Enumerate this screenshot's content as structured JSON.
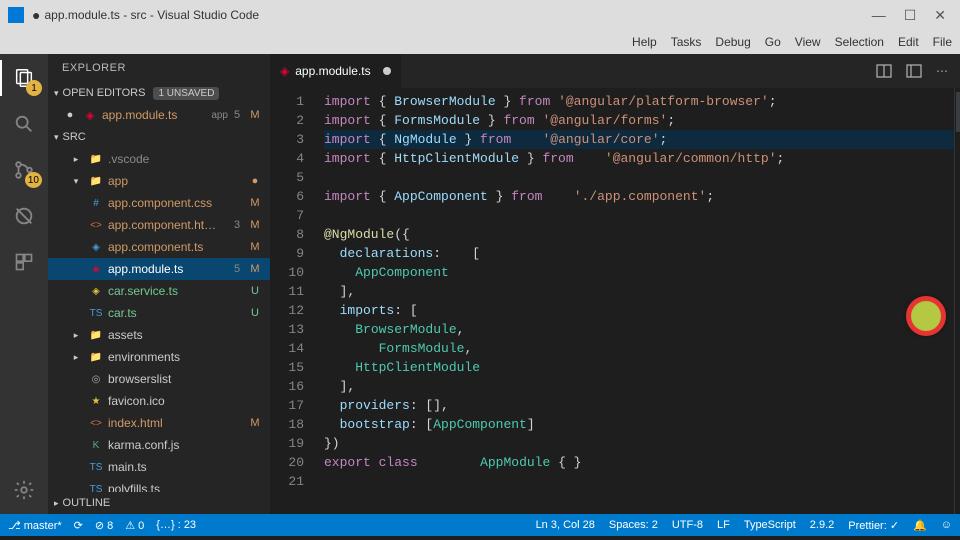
{
  "title": {
    "modified": "●",
    "filename": "app.module.ts",
    "path": "src",
    "app": "Visual Studio Code"
  },
  "window": {
    "min": "—",
    "max": "☐",
    "close": "✕"
  },
  "menu": [
    "Help",
    "Tasks",
    "Debug",
    "Go",
    "View",
    "Selection",
    "Edit",
    "File"
  ],
  "activity": {
    "explorer_badge": "1",
    "scm_badge": "10"
  },
  "sidebar": {
    "title": "EXPLORER",
    "open_editors": {
      "label": "OPEN EDITORS",
      "badge": "1 UNSAVED"
    },
    "open_editors_items": [
      {
        "dirty": "●",
        "icon": "◈",
        "label": "app.module.ts",
        "extra": "app",
        "num": "5",
        "status": "M",
        "iconColor": "#dd0531"
      }
    ],
    "src_label": "SRC",
    "tree": [
      {
        "indent": 20,
        "chev": "▸",
        "icon": "📁",
        "label": ".vscode",
        "color": "#8a8a8a",
        "iconColor": "#6aa0c8"
      },
      {
        "indent": 20,
        "chev": "▾",
        "icon": "📁",
        "label": "app",
        "status": "●",
        "statusClass": "M",
        "color": "#d19a66",
        "iconColor": "#c97b4a"
      },
      {
        "indent": 40,
        "icon": "#",
        "label": "app.component.css",
        "status": "M",
        "statusClass": "M",
        "color": "#d19a66",
        "iconColor": "#4a9cd6"
      },
      {
        "indent": 40,
        "icon": "<>",
        "label": "app.component.ht…",
        "num": "3",
        "status": "M",
        "statusClass": "M",
        "color": "#d19a66",
        "iconColor": "#d16d42"
      },
      {
        "indent": 40,
        "icon": "◈",
        "label": "app.component.ts",
        "status": "M",
        "statusClass": "M",
        "color": "#d19a66",
        "iconColor": "#4a9cd6"
      },
      {
        "indent": 40,
        "icon": "◈",
        "label": "app.module.ts",
        "num": "5",
        "status": "M",
        "statusClass": "M",
        "active": true,
        "iconColor": "#dd0531"
      },
      {
        "indent": 40,
        "icon": "◈",
        "label": "car.service.ts",
        "status": "U",
        "statusClass": "U",
        "color": "#73c991",
        "iconColor": "#e2c23a"
      },
      {
        "indent": 40,
        "icon": "TS",
        "label": "car.ts",
        "status": "U",
        "statusClass": "U",
        "color": "#73c991",
        "iconColor": "#4a9cd6"
      },
      {
        "indent": 20,
        "chev": "▸",
        "icon": "📁",
        "label": "assets",
        "iconColor": "#8a8a8a"
      },
      {
        "indent": 20,
        "chev": "▸",
        "icon": "📁",
        "label": "environments",
        "iconColor": "#8a8a8a"
      },
      {
        "indent": 40,
        "icon": "◎",
        "label": "browserslist",
        "iconColor": "#a8a8a8"
      },
      {
        "indent": 40,
        "icon": "★",
        "label": "favicon.ico",
        "iconColor": "#e2c23a"
      },
      {
        "indent": 40,
        "icon": "<>",
        "label": "index.html",
        "status": "M",
        "statusClass": "M",
        "color": "#d19a66",
        "iconColor": "#d16d42"
      },
      {
        "indent": 40,
        "icon": "K",
        "label": "karma.conf.js",
        "iconColor": "#5aa888"
      },
      {
        "indent": 40,
        "icon": "TS",
        "label": "main.ts",
        "iconColor": "#4a9cd6"
      },
      {
        "indent": 40,
        "icon": "TS",
        "label": "polyfills.ts",
        "iconColor": "#4a9cd6"
      }
    ],
    "outline": "OUTLINE"
  },
  "tab": {
    "filename": "app.module.ts"
  },
  "code": {
    "lines": [
      [
        [
          "kw",
          "import"
        ],
        [
          "pl",
          " { "
        ],
        [
          "id",
          "BrowserModule"
        ],
        [
          "pl",
          " } "
        ],
        [
          "kw",
          "from"
        ],
        [
          "pl",
          " "
        ],
        [
          "str",
          "'@angular/platform-browser'"
        ],
        [
          "pl",
          ";"
        ]
      ],
      [
        [
          "kw",
          "import"
        ],
        [
          "pl",
          " { "
        ],
        [
          "id",
          "FormsModule"
        ],
        [
          "pl",
          " } "
        ],
        [
          "kw",
          "from"
        ],
        [
          "pl",
          " "
        ],
        [
          "str",
          "'@angular/forms'"
        ],
        [
          "pl",
          ";"
        ]
      ],
      [
        [
          "kw",
          "import"
        ],
        [
          "pl",
          " { "
        ],
        [
          "id",
          "NgModule"
        ],
        [
          "pl",
          " } "
        ],
        [
          "kw",
          "from"
        ],
        [
          "pl",
          "    "
        ],
        [
          "str",
          "'@angular/core'"
        ],
        [
          "pl",
          ";"
        ]
      ],
      [
        [
          "kw",
          "import"
        ],
        [
          "pl",
          " { "
        ],
        [
          "id",
          "HttpClientModule"
        ],
        [
          "pl",
          " } "
        ],
        [
          "kw",
          "from"
        ],
        [
          "pl",
          "    "
        ],
        [
          "str",
          "'@angular/common/http'"
        ],
        [
          "pl",
          ";"
        ]
      ],
      [],
      [
        [
          "kw",
          "import"
        ],
        [
          "pl",
          " { "
        ],
        [
          "id",
          "AppComponent"
        ],
        [
          "pl",
          " } "
        ],
        [
          "kw",
          "from"
        ],
        [
          "pl",
          "    "
        ],
        [
          "str",
          "'./app.component'"
        ],
        [
          "pl",
          ";"
        ]
      ],
      [],
      [
        [
          "dec",
          "@NgModule"
        ],
        [
          "pl",
          "({"
        ]
      ],
      [
        [
          "pl",
          "  "
        ],
        [
          "id",
          "declarations"
        ],
        [
          "pl",
          ":    ["
        ]
      ],
      [
        [
          "pl",
          "    "
        ],
        [
          "cls",
          "AppComponent"
        ]
      ],
      [
        [
          "pl",
          "  ],"
        ]
      ],
      [
        [
          "pl",
          "  "
        ],
        [
          "id",
          "imports"
        ],
        [
          "pl",
          ": ["
        ]
      ],
      [
        [
          "pl",
          "    "
        ],
        [
          "cls",
          "BrowserModule"
        ],
        [
          "pl",
          ","
        ]
      ],
      [
        [
          "pl",
          "       "
        ],
        [
          "cls",
          "FormsModule"
        ],
        [
          "pl",
          ","
        ]
      ],
      [
        [
          "pl",
          "    "
        ],
        [
          "cls",
          "HttpClientModule"
        ]
      ],
      [
        [
          "pl",
          "  ],"
        ]
      ],
      [
        [
          "pl",
          "  "
        ],
        [
          "id",
          "providers"
        ],
        [
          "pl",
          ": [],"
        ]
      ],
      [
        [
          "pl",
          "  "
        ],
        [
          "id",
          "bootstrap"
        ],
        [
          "pl",
          ": ["
        ],
        [
          "cls",
          "AppComponent"
        ],
        [
          "pl",
          "]"
        ]
      ],
      [
        [
          "pl",
          "})"
        ]
      ],
      [
        [
          "kw",
          "export"
        ],
        [
          "pl",
          " "
        ],
        [
          "kw",
          "class"
        ],
        [
          "pl",
          "        "
        ],
        [
          "cls",
          "AppModule"
        ],
        [
          "pl",
          " { }"
        ]
      ],
      []
    ],
    "highlight_line": 3
  },
  "status": {
    "branch": "master*",
    "sync": "⟳",
    "errors": "⊘ 8",
    "warnings": "⚠ 0",
    "info": "{…} : 23",
    "cursor": "Ln 3, Col 28",
    "spaces": "Spaces: 2",
    "encoding": "UTF-8",
    "eol": "LF",
    "lang": "TypeScript",
    "ver": "2.9.2",
    "prettier": "Prettier: ✓",
    "bell": "🔔",
    "smile": "☺"
  }
}
